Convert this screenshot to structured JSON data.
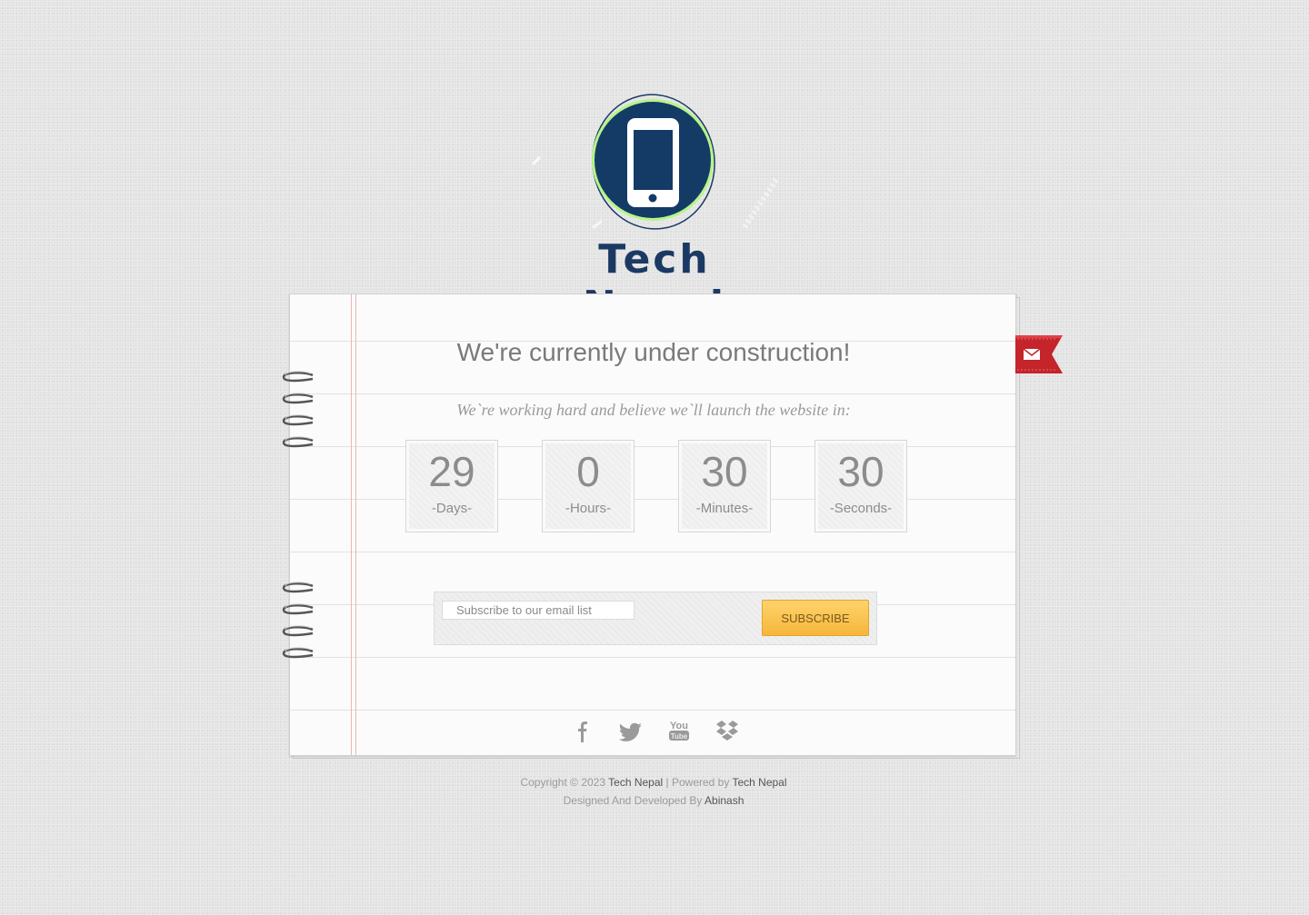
{
  "brand": {
    "name": "Tech Nepal"
  },
  "notice": {
    "heading": "We're currently under construction!",
    "subheading": "We`re working hard and believe we`ll launch the website in:"
  },
  "countdown": [
    {
      "value": "29",
      "label": "-Days-"
    },
    {
      "value": "0",
      "label": "-Hours-"
    },
    {
      "value": "30",
      "label": "-Minutes-"
    },
    {
      "value": "30",
      "label": "-Seconds-"
    }
  ],
  "subscribe": {
    "placeholder": "Subscribe to our email list",
    "button_label": "SUBSCRIBE"
  },
  "social": [
    "facebook-icon",
    "twitter-icon",
    "youtube-icon",
    "dropbox-icon"
  ],
  "ribbon_icon": "mail-icon",
  "footer": {
    "copyright_prefix": "Copyright © 2023",
    "copyright_link": "Tech Nepal",
    "powered_prefix": "| Powered by",
    "powered_link": "Tech Nepal",
    "designed_prefix": "Designed And Developed By",
    "designer_link": "Abinash"
  },
  "colors": {
    "brand_navy": "#1b3a63",
    "logo_green": "#b5f58a",
    "ribbon_red": "#c4242a",
    "button_yellow": "#f7b63b"
  }
}
